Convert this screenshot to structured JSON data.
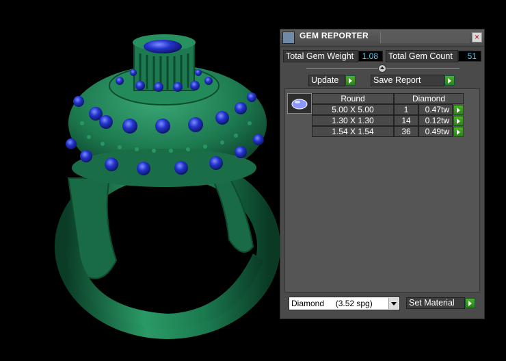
{
  "panel": {
    "title": "GEM REPORTER",
    "close_label": "×",
    "total_gem_weight_label": "Total Gem Weight",
    "total_gem_weight_value": "1.08",
    "total_gem_count_label": "Total Gem Count",
    "total_gem_count_value": "51",
    "update_label": "Update",
    "save_report_label": "Save Report",
    "table": {
      "shape_header": "Round",
      "material_header": "Diamond",
      "rows": [
        {
          "size": "5.00 X 5.00",
          "count": "1",
          "weight": "0.47tw"
        },
        {
          "size": "1.30 X 1.30",
          "count": "14",
          "weight": "0.12tw"
        },
        {
          "size": "1.54 X 1.54",
          "count": "36",
          "weight": "0.49tw"
        }
      ]
    },
    "material_select": "Diamond     (3.52 spg)",
    "set_material_label": "Set Material"
  },
  "colors": {
    "ring": "#1f7a52",
    "gems": "#2233cc",
    "panel_bg": "#4a4a4a",
    "value_text": "#4fd0ff",
    "go_button": "#3a9a20"
  },
  "icons": {
    "app": "gem-reporter-icon",
    "close": "close-icon",
    "go": "play-arrow-icon",
    "thumb": "round-gem-icon"
  }
}
